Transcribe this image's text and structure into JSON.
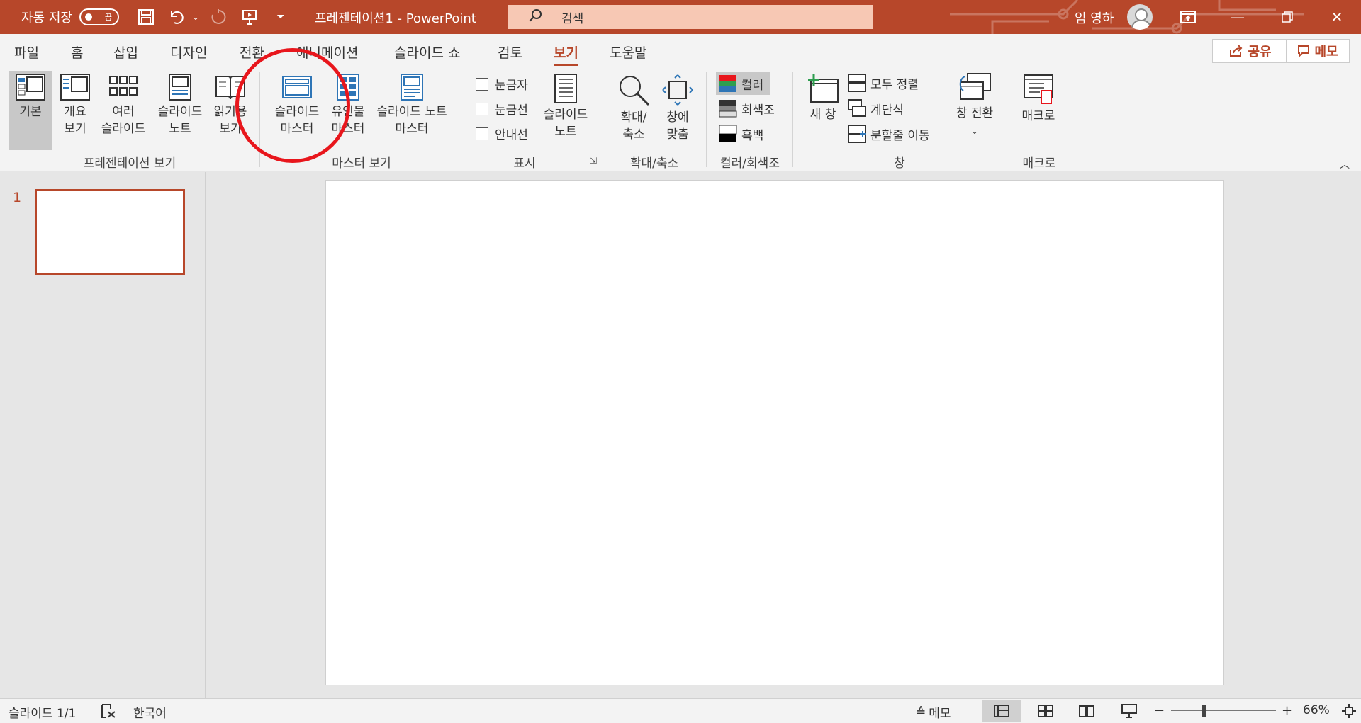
{
  "titlebar": {
    "autosave_label": "자동 저장",
    "autosave_state": "끔",
    "doc_title": "프레젠테이션1  -  PowerPoint",
    "search_placeholder": "검색",
    "user_name": "임 영하"
  },
  "tabs": [
    {
      "label": "파일"
    },
    {
      "label": "홈"
    },
    {
      "label": "삽입"
    },
    {
      "label": "디자인"
    },
    {
      "label": "전환"
    },
    {
      "label": "애니메이션"
    },
    {
      "label": "슬라이드 쇼"
    },
    {
      "label": "검토"
    },
    {
      "label": "보기",
      "active": true
    },
    {
      "label": "도움말"
    }
  ],
  "share_label": "공유",
  "memo_label": "메모",
  "ribbon": {
    "presentation_views": {
      "label": "프레젠테이션 보기",
      "normal": [
        "기본"
      ],
      "outline": [
        "개요",
        "보기"
      ],
      "sorter": [
        "여러",
        "슬라이드"
      ],
      "notes": [
        "슬라이드",
        "노트"
      ],
      "reading": [
        "읽기용",
        "보기"
      ]
    },
    "master_views": {
      "label": "마스터 보기",
      "slide_master": [
        "슬라이드",
        "마스터"
      ],
      "handout_master": [
        "유인물",
        "마스터"
      ],
      "notes_master": [
        "슬라이드 노트",
        "마스터"
      ]
    },
    "show": {
      "label": "표시",
      "ruler": "눈금자",
      "gridlines": "눈금선",
      "guides": "안내선",
      "notes": [
        "슬라이드",
        "노트"
      ]
    },
    "zoom": {
      "label": "확대/축소",
      "zoom": [
        "확대/",
        "축소"
      ],
      "fit": [
        "창에",
        "맞춤"
      ]
    },
    "color": {
      "label": "컬러/회색조",
      "color": "컬러",
      "grayscale": "회색조",
      "bw": "흑백"
    },
    "window": {
      "label": "창",
      "new_window": "새 창",
      "arrange_all": "모두 정렬",
      "cascade": "계단식",
      "move_split": "분할줄 이동",
      "switch": "창 전환"
    },
    "macros": {
      "label": "매크로",
      "macros": "매크로"
    }
  },
  "slides": {
    "number": "1"
  },
  "statusbar": {
    "slide_info": "슬라이드 1/1",
    "language": "한국어",
    "notes": "메모",
    "zoom_level": "66%"
  }
}
